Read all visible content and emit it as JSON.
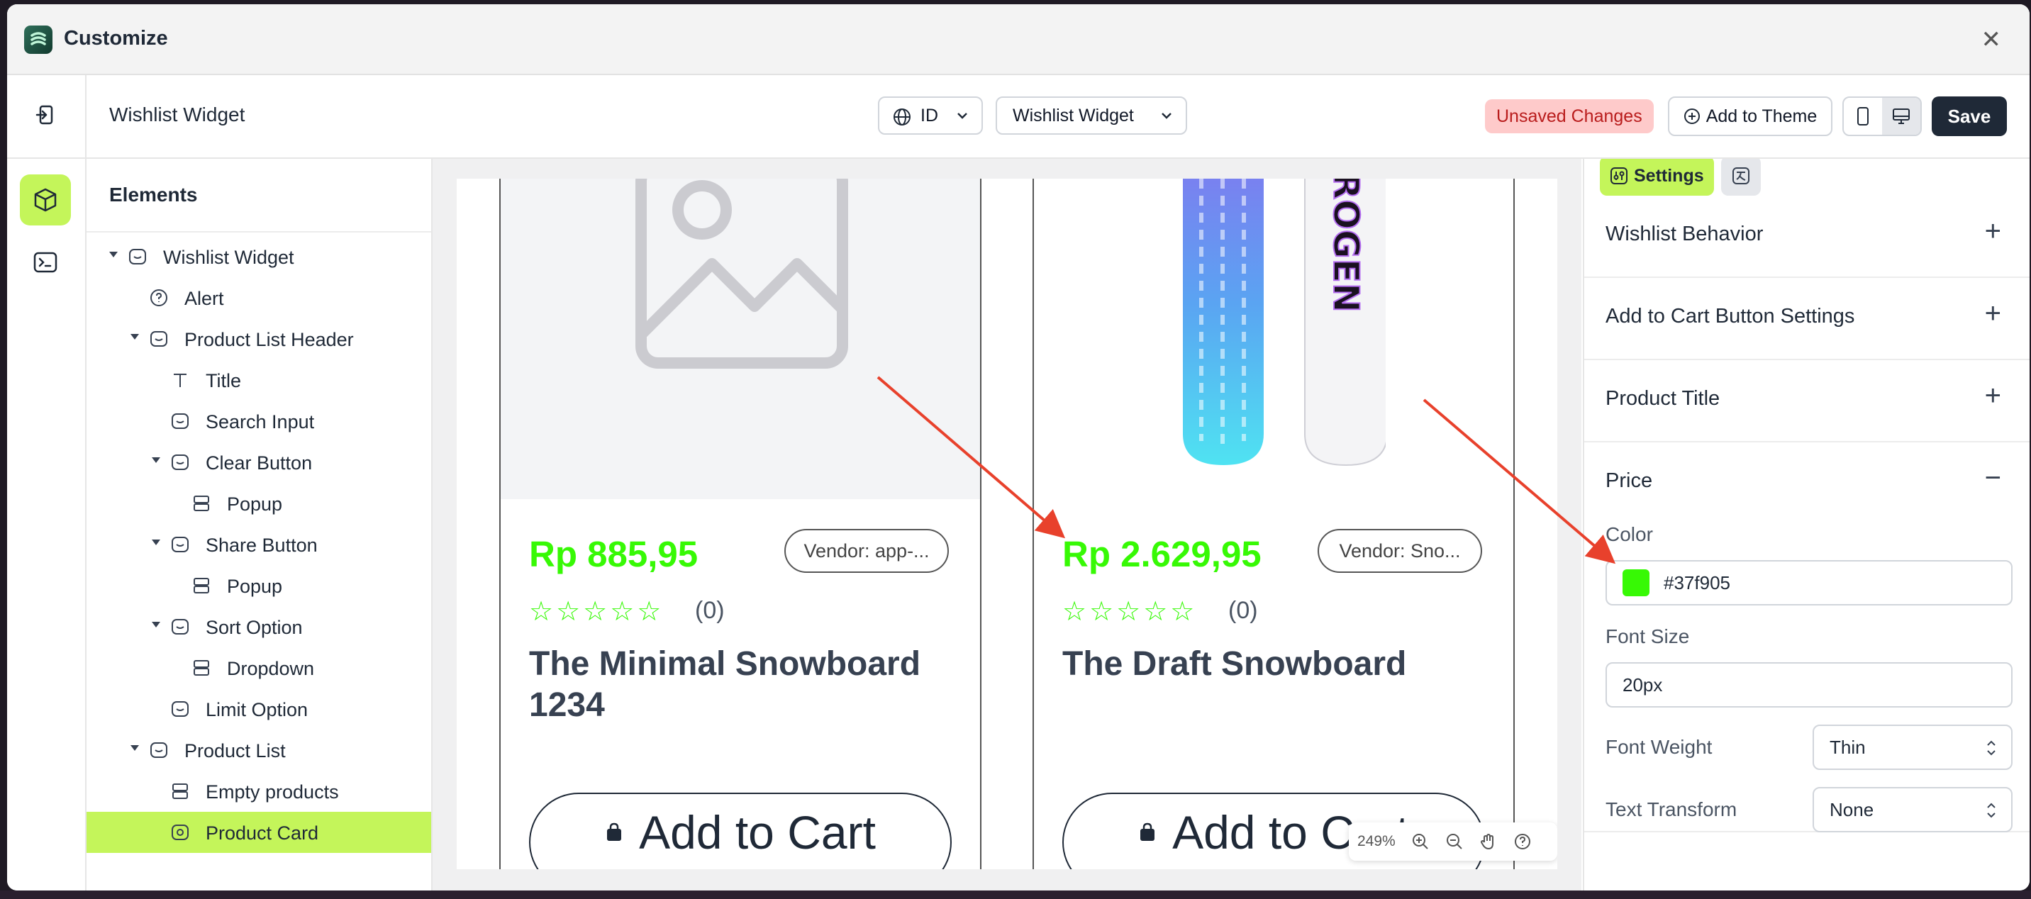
{
  "window": {
    "title": "Customize"
  },
  "toolbar": {
    "page_name": "Wishlist Widget",
    "language": "ID",
    "widget_select": "Wishlist Widget",
    "unsaved": "Unsaved Changes",
    "add_to_theme": "Add to Theme",
    "save": "Save"
  },
  "tree": {
    "header": "Elements",
    "nodes": [
      {
        "label": "Wishlist Widget"
      },
      {
        "label": "Alert"
      },
      {
        "label": "Product List Header"
      },
      {
        "label": "Title"
      },
      {
        "label": "Search Input"
      },
      {
        "label": "Clear Button"
      },
      {
        "label": "Popup"
      },
      {
        "label": "Share Button"
      },
      {
        "label": "Popup"
      },
      {
        "label": "Sort Option"
      },
      {
        "label": "Dropdown"
      },
      {
        "label": "Limit Option"
      },
      {
        "label": "Product List"
      },
      {
        "label": "Empty products"
      },
      {
        "label": "Product Card"
      }
    ]
  },
  "preview": {
    "cards": [
      {
        "price": "Rp 885,95",
        "vendor": "Vendor: app-...",
        "stars": "☆☆☆☆☆",
        "rating": "(0)",
        "name": "The Minimal Snowboard 1234",
        "cart": "Add to Cart"
      },
      {
        "price": "Rp 2.629,95",
        "vendor": "Vendor: Sno...",
        "stars": "☆☆☆☆☆",
        "rating": "(0)",
        "name": "The Draft Snowboard",
        "cart": "Add to Cart"
      }
    ],
    "board_text": "HYDROGEN",
    "zoom": "249%"
  },
  "panel": {
    "tab_settings": "Settings",
    "sections": [
      {
        "title": "Wishlist Behavior",
        "toggle": "+"
      },
      {
        "title": "Add to Cart Button Settings",
        "toggle": "+"
      },
      {
        "title": "Product Title",
        "toggle": "+"
      },
      {
        "title": "Price",
        "toggle": "−"
      }
    ],
    "color_label": "Color",
    "color_value": "#37f905",
    "font_size_label": "Font Size",
    "font_size_value": "20px",
    "font_weight_label": "Font Weight",
    "font_weight_value": "Thin",
    "text_transform_label": "Text Transform",
    "text_transform_value": "None"
  },
  "colors": {
    "accent": "#c4f55a",
    "price": "#37f905",
    "unsaved_bg": "#fecaca",
    "unsaved_text": "#b91c1c",
    "save_bg": "#1f2937",
    "arrow": "#e8412c"
  }
}
